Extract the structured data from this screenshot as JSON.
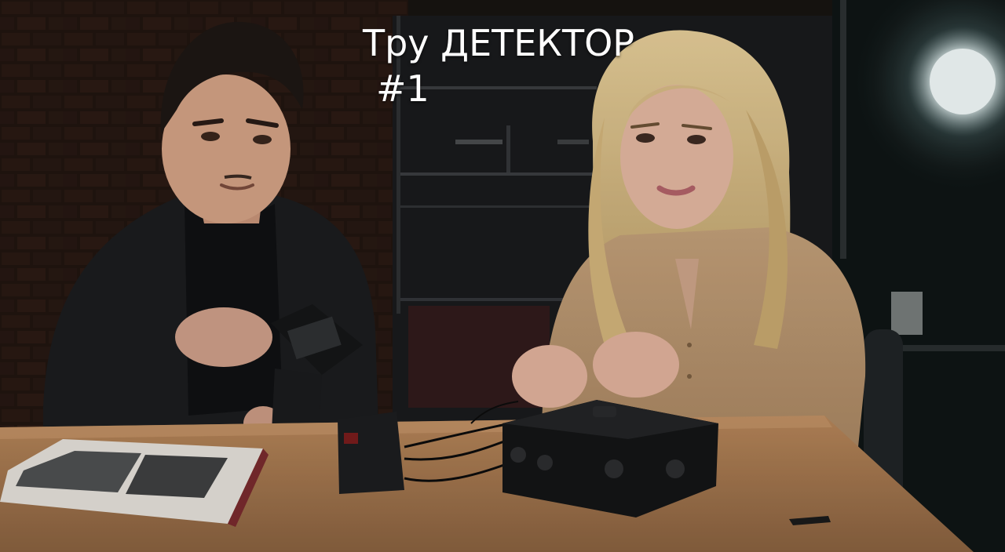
{
  "caption": {
    "title": "Тру ДЕТЕКТОР",
    "number": "#1"
  }
}
